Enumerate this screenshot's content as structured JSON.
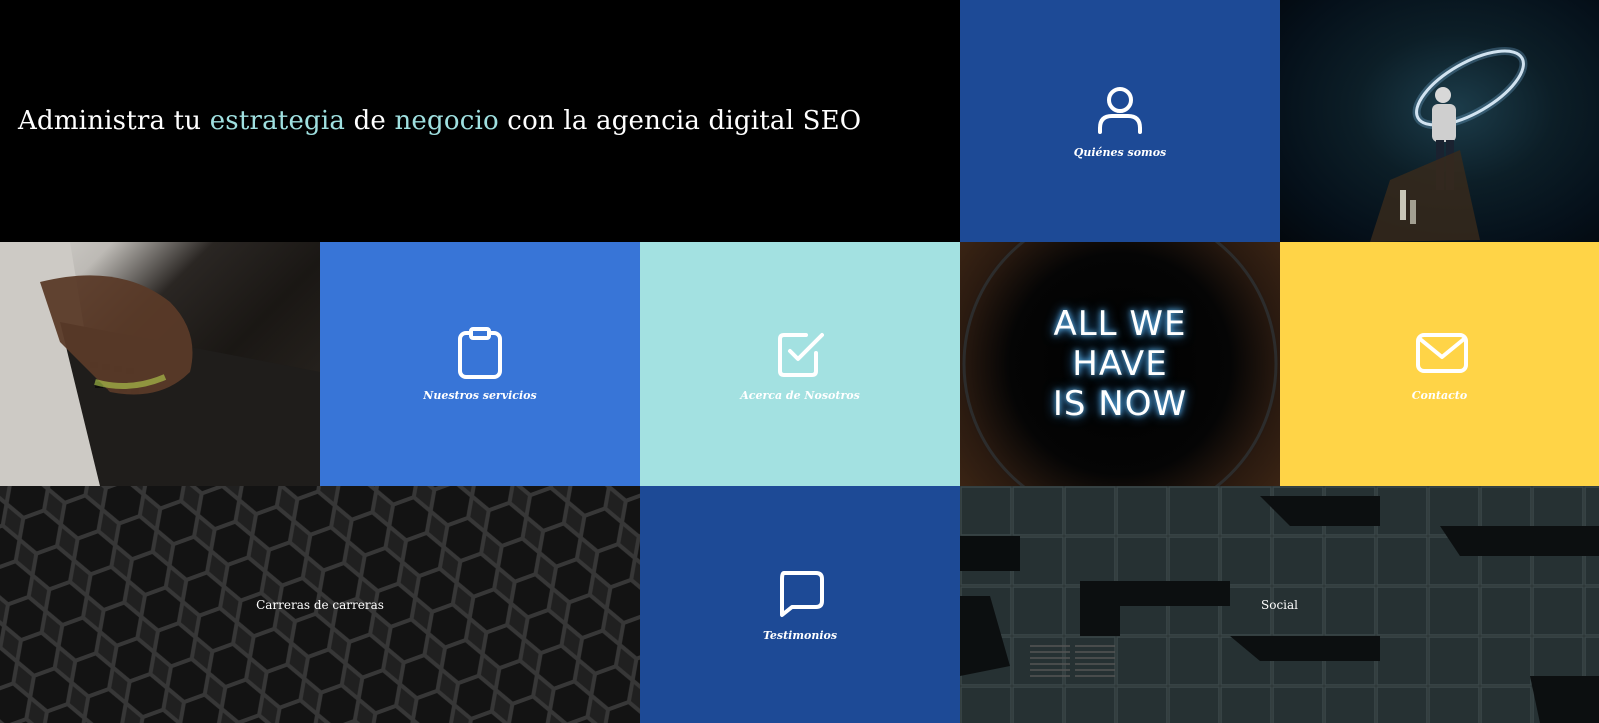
{
  "hero": {
    "title_part1": "Administra tu ",
    "title_highlight1": "estrategia",
    "title_part2": " de ",
    "title_highlight2": "negocio",
    "title_part3": " con la agencia digital SEO"
  },
  "tiles": {
    "quienes": {
      "label": "Quiénes somos",
      "icon": "user-icon",
      "color": "#1d4a96"
    },
    "servicios": {
      "label": "Nuestros servicios",
      "icon": "clipboard-icon",
      "color": "#3875d7"
    },
    "acerca": {
      "label": "Acerca de Nosotros",
      "icon": "checkbox-icon",
      "color": "#a3e1e1"
    },
    "contacto": {
      "label": "Contacto",
      "icon": "mail-icon",
      "color": "#ffd447"
    },
    "carreras": {
      "label": "Carreras de carreras"
    },
    "testimonios": {
      "label": "Testimonios",
      "icon": "chat-bubble-icon",
      "color": "#1d4a96"
    },
    "social": {
      "label": "Social"
    }
  },
  "neon_sign": {
    "line1": "ALL WE",
    "line2": "HAVE",
    "line3": "IS NOW"
  },
  "colors": {
    "highlight": "#9fe0e0",
    "dark_blue": "#1d4a96",
    "mid_blue": "#3875d7",
    "teal": "#a3e1e1",
    "yellow": "#ffd447"
  }
}
